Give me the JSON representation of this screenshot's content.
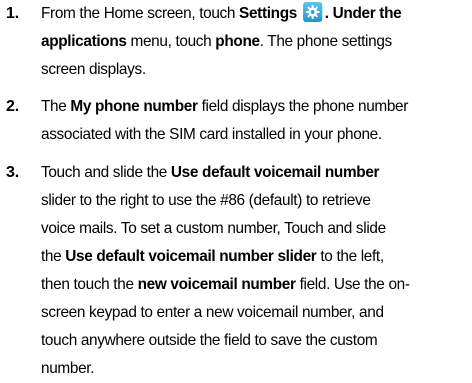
{
  "steps": [
    {
      "number": "1.",
      "lines": [
        {
          "pre": "From the Home screen, touch ",
          "b1": "Settings",
          "icon": "settings-gear-icon",
          "post": ". Under the"
        },
        {
          "b1": "applications",
          "mid": " menu, touch ",
          "b2": "phone",
          "post": ". The phone settings"
        },
        {
          "pre": "screen displays."
        }
      ]
    },
    {
      "number": "2.",
      "lines": [
        {
          "pre": "The ",
          "b1": "My phone number",
          "post": " field displays the phone number"
        },
        {
          "pre": "associated with the SIM card installed in your phone."
        }
      ]
    },
    {
      "number": "3.",
      "lines": [
        {
          "pre": "Touch and slide the ",
          "b1": "Use default voicemail number"
        },
        {
          "pre": "slider to the right to use the #86 (default) to retrieve"
        },
        {
          "pre": "voice mails. To set a custom number, Touch and slide"
        },
        {
          "pre": "the ",
          "b1": "Use default voicemail number slider",
          "post": " to the left,"
        },
        {
          "pre": "then touch the ",
          "b1": "new voicemail number",
          "post": " field. Use the on-"
        },
        {
          "pre": "screen keypad to enter a new voicemail number, and"
        },
        {
          "pre": "touch anywhere outside the field to save the custom"
        },
        {
          "pre": "number."
        }
      ]
    }
  ]
}
